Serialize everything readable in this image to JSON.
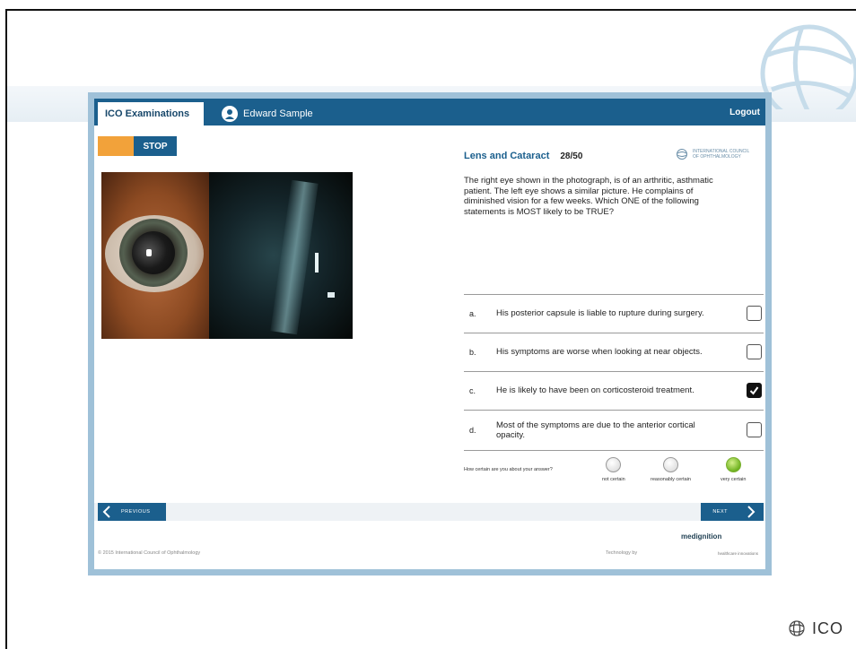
{
  "header": {
    "app_tab": "ICO Examinations",
    "user_name": "Edward Sample",
    "logout": "Logout"
  },
  "controls": {
    "stop": "STOP"
  },
  "question": {
    "category": "Lens and Cataract",
    "counter": "28/50",
    "text": "The right eye shown in the photograph, is of an arthritic, asthmatic patient. The left eye shows a similar picture. He complains of diminished vision for a few weeks. Which ONE of the following statements is MOST likely to be TRUE?",
    "options": [
      {
        "letter": "a.",
        "text": "His posterior capsule is liable to rupture during surgery.",
        "checked": false
      },
      {
        "letter": "b.",
        "text": "His symptoms are worse when looking at near objects.",
        "checked": false
      },
      {
        "letter": "c.",
        "text": "He is likely to have been on corticosteroid treatment.",
        "checked": true
      },
      {
        "letter": "d.",
        "text": "Most of the symptoms are due to the anterior cortical opacity.",
        "checked": false
      }
    ]
  },
  "certainty": {
    "label": "How certain are you about your answer?",
    "options": [
      {
        "label": "not certain",
        "selected": false
      },
      {
        "label": "reasonably certain",
        "selected": false
      },
      {
        "label": "very certain",
        "selected": true
      }
    ]
  },
  "nav": {
    "previous": "PREVIOUS",
    "next": "NEXT"
  },
  "footer": {
    "copyright": "© 2015 International Council of Ophthalmology",
    "technology_by": "Technology by",
    "brand": "medignition",
    "brand_sub": "healthcare innovations"
  },
  "council_logo_text": "INTERNATIONAL COUNCIL OF OPHTHALMOLOGY",
  "slide_logo": "ICO",
  "colors": {
    "primary": "#1b5f8d",
    "accent": "#f2a23a",
    "selected_radio": "#6fb320"
  }
}
